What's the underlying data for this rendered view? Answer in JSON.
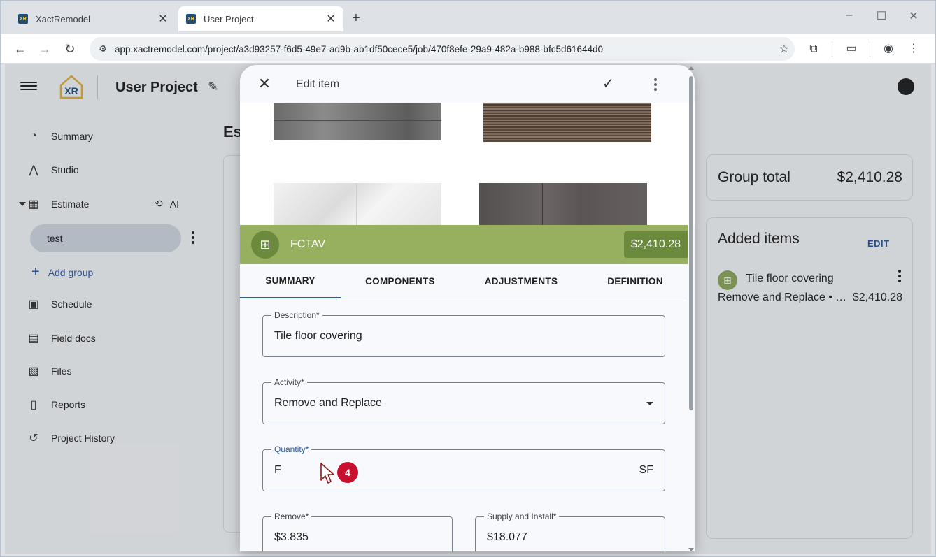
{
  "browser": {
    "tabs": [
      {
        "title": "XactRemodel",
        "active": false
      },
      {
        "title": "User Project",
        "active": true
      }
    ],
    "url": "app.xactremodel.com/project/a3d93257-f6d5-49e7-ad9b-ab1df50cece5/job/470f8efe-29a9-482a-b988-bfc5d61644d0"
  },
  "app": {
    "logo_text": "XR",
    "project_title": "User Project",
    "estimate_heading": "Es",
    "nav": [
      {
        "label": "Summary",
        "icon": "speedometer-icon"
      },
      {
        "label": "Studio",
        "icon": "compass-icon"
      },
      {
        "label": "Estimate",
        "icon": "calculator-icon"
      },
      {
        "label": "Schedule",
        "icon": "calendar-icon"
      },
      {
        "label": "Field docs",
        "icon": "clipboard-icon"
      },
      {
        "label": "Files",
        "icon": "images-icon"
      },
      {
        "label": "Reports",
        "icon": "document-icon"
      },
      {
        "label": "Project History",
        "icon": "history-icon"
      }
    ],
    "ai_label": "AI",
    "group_name": "test",
    "add_group_label": "Add group"
  },
  "right_panel": {
    "group_total_label": "Group total",
    "group_total_value": "$2,410.28",
    "added_items_label": "Added items",
    "edit_label": "EDIT",
    "item_name": "Tile floor covering",
    "item_sub": "Remove and Replace • Tile floor covering",
    "item_price": "$2,410.28"
  },
  "modal": {
    "title": "Edit item",
    "item_code": "FCTAV",
    "item_price": "$2,410.28",
    "tabs": [
      "SUMMARY",
      "COMPONENTS",
      "ADJUSTMENTS",
      "DEFINITION"
    ],
    "active_tab": "SUMMARY",
    "fields": {
      "description": {
        "label": "Description*",
        "value": "Tile floor covering"
      },
      "activity": {
        "label": "Activity*",
        "value": "Remove and Replace"
      },
      "quantity": {
        "label": "Quantity*",
        "value": "F",
        "unit": "SF"
      },
      "remove": {
        "label": "Remove*",
        "value": "$3.835"
      },
      "supply_install": {
        "label": "Supply and Install*",
        "value": "$18.077"
      }
    }
  },
  "annotation": {
    "step_number": "4"
  },
  "colors": {
    "accent_blue": "#2d5aa0",
    "banner_green": "#96b05f",
    "banner_dark_green": "#6b8a3e",
    "step_badge_red": "#c8102e"
  }
}
